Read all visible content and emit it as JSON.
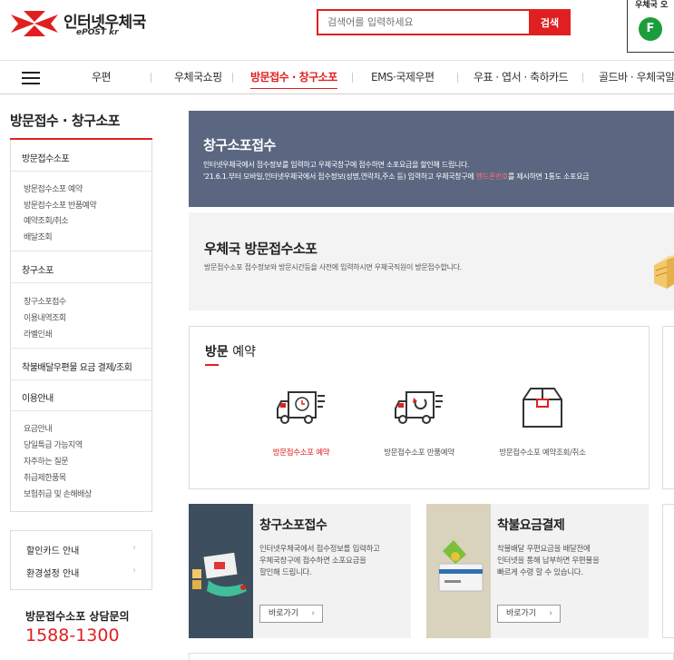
{
  "header": {
    "logo_name": "인터넷우체국",
    "logo_sub": "ePOST kr",
    "search_placeholder": "검색어를 입력하세요",
    "search_button": "검색",
    "weather_title": "우체국 오",
    "grade": "F"
  },
  "gnb": {
    "items": [
      {
        "label": "우편"
      },
      {
        "label": "우체국쇼핑"
      },
      {
        "label": "방문접수 · 창구소포"
      },
      {
        "label": "EMS·국제우편"
      },
      {
        "label": "우표 · 엽서 · 축하카드"
      },
      {
        "label": "골드바 · 우체국알"
      }
    ]
  },
  "sidebar": {
    "title": "방문접수 · 창구소포",
    "sections": [
      {
        "label": "방문접수소포",
        "subs": [
          "방문접수소포 예약",
          "방문접수소포 반품예약",
          "예약조회/취소",
          "배달조회"
        ]
      },
      {
        "label": "창구소포",
        "subs": [
          "창구소포접수",
          "이용내역조회",
          "라벨인쇄"
        ]
      },
      {
        "label": "착불배달우편물 요금 결제/조회",
        "subs": []
      },
      {
        "label": "이용안내",
        "subs": [
          "요금안내",
          "당일특급 가능지역",
          "자주하는 질문",
          "취급제한품목",
          "보험취급 및 손해배상"
        ]
      }
    ],
    "links": [
      "할인카드 안내",
      "환경설정 안내"
    ],
    "chevron": "›",
    "cs_title": "방문접수소포 상담문의",
    "cs_phone": "1588-1300"
  },
  "banner": {
    "title": "창구소포접수",
    "line1": "인터넷우체국에서 접수정보를 입력하고 우체국창구에 접수하면 소포요금을 할인해 드립니다.",
    "line2_pre": "'21.6.1.부터 모바일,인터넷우체국에서 접수정보(성명,연락처,주소 등) 입력하고 우체국창구에 ",
    "line2_hl": "핸드폰번호",
    "line2_post": "를 제시하면 1통도 소포요금"
  },
  "visit": {
    "title": "우체국 방문접수소포",
    "desc": "방문접수소포 접수정보와 방문시간등을 사전에 입력하시면 우체국직원이 방문접수합니다."
  },
  "reserve": {
    "title_bold": "방문",
    "title_rest": " 예약",
    "items": [
      {
        "label": "방문접수소포 예약",
        "icon": "truck-clock-icon"
      },
      {
        "label": "방문접수소포 반품예약",
        "icon": "truck-return-icon"
      },
      {
        "label": "방문접수소포 예약조회/취소",
        "icon": "box-icon"
      }
    ]
  },
  "cards": [
    {
      "title": "창구소포접수",
      "desc": [
        "인터넷우체국에서 접수정보를 입력하고",
        "우체국창구에 접수하면 소포요금을",
        "할인해 드립니다."
      ],
      "button": "바로가기",
      "thumb_color": "#3d4e5e"
    },
    {
      "title": "착불요금결제",
      "desc": [
        "착불배달 우편요금을 배달전에",
        "인터넷을 통해 납부하면 우편물을",
        "빠르게 수령 할 수 있습니다."
      ],
      "button": "바로가기",
      "thumb_color": "#d9d2bd"
    }
  ],
  "button_arrow": "›",
  "colors": {
    "accent": "#e02020",
    "banner": "#5b6781",
    "grade": "#1a9e3b"
  }
}
